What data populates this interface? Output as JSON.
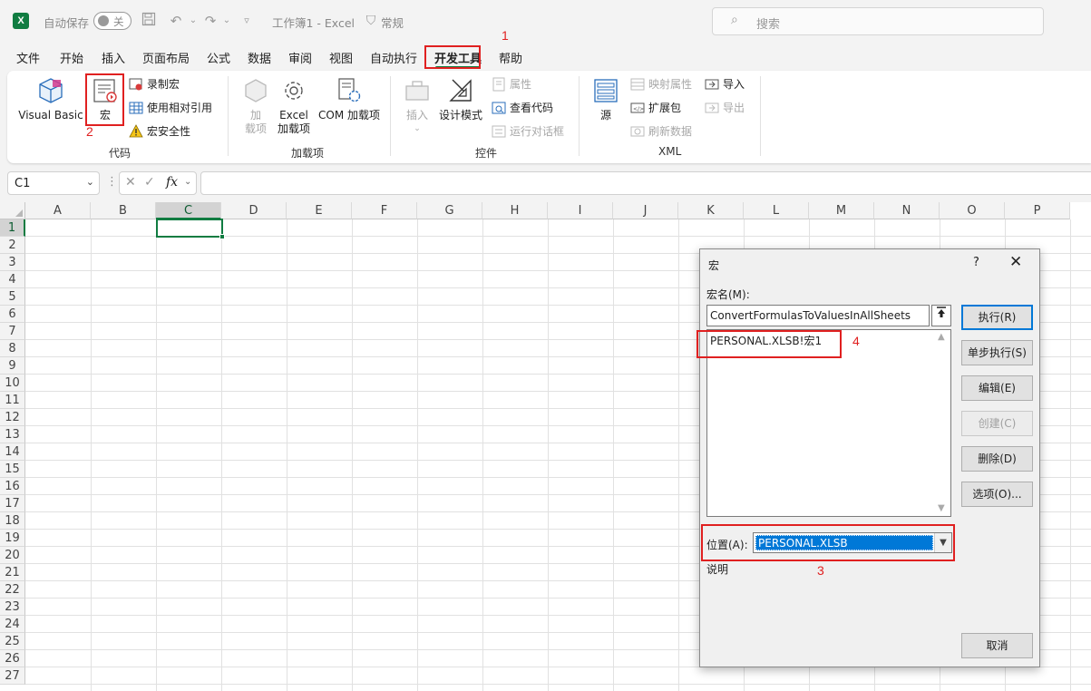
{
  "titlebar": {
    "logo": "X",
    "autosave_label": "自动保存",
    "autosave_state": "关",
    "doc_title": "工作簿1  -  Excel",
    "sensitivity": "常规",
    "search_placeholder": "搜索"
  },
  "tabs": [
    "文件",
    "开始",
    "插入",
    "页面布局",
    "公式",
    "数据",
    "审阅",
    "视图",
    "自动执行",
    "开发工具",
    "帮助"
  ],
  "active_tab": "开发工具",
  "ribbon": {
    "code": {
      "label": "代码",
      "visual_basic": "Visual Basic",
      "macros": "宏",
      "record_macro": "录制宏",
      "relative_ref": "使用相对引用",
      "macro_security": "宏安全性"
    },
    "addins": {
      "label": "加载项",
      "addins_line1": "加",
      "addins_line2": "载项",
      "excel_addins_line1": "Excel",
      "excel_addins_line2": "加载项",
      "com_addins": "COM 加载项"
    },
    "controls": {
      "label": "控件",
      "insert": "插入",
      "design_mode": "设计模式",
      "properties": "属性",
      "view_code": "查看代码",
      "run_dialog": "运行对话框"
    },
    "xml": {
      "label": "XML",
      "source": "源",
      "map_properties": "映射属性",
      "expansion_packs": "扩展包",
      "refresh_data": "刷新数据",
      "import": "导入",
      "export": "导出"
    }
  },
  "formula_bar": {
    "name_box": "C1",
    "fx": "fx",
    "value": ""
  },
  "sheet": {
    "columns": [
      "A",
      "B",
      "C",
      "D",
      "E",
      "F",
      "G",
      "H",
      "I",
      "J",
      "K",
      "L",
      "M",
      "N",
      "O",
      "P"
    ],
    "rows": [
      "1",
      "2",
      "3",
      "4",
      "5",
      "6",
      "7",
      "8",
      "9",
      "10",
      "11",
      "12",
      "13",
      "14",
      "15",
      "16",
      "17",
      "18",
      "19",
      "20",
      "21",
      "22",
      "23",
      "24",
      "25",
      "26",
      "27"
    ],
    "selected_cell": "C1"
  },
  "dialog": {
    "title": "宏",
    "help": "?",
    "close": "✕",
    "macro_name_label": "宏名(M):",
    "macro_name_value": "ConvertFormulasToValuesInAllSheets",
    "macro_list": [
      "PERSONAL.XLSB!宏1"
    ],
    "location_label": "位置(A):",
    "location_value": "PERSONAL.XLSB",
    "description_label": "说明",
    "buttons": {
      "run": "执行(R)",
      "step_into": "单步执行(S)",
      "edit": "编辑(E)",
      "create": "创建(C)",
      "delete": "删除(D)",
      "options": "选项(O)...",
      "cancel": "取消"
    }
  },
  "annotations": [
    "1",
    "2",
    "3",
    "4"
  ],
  "colors": {
    "excel_green": "#107c41",
    "annotation_red": "#e02020",
    "dialog_highlight": "#0078d7"
  }
}
